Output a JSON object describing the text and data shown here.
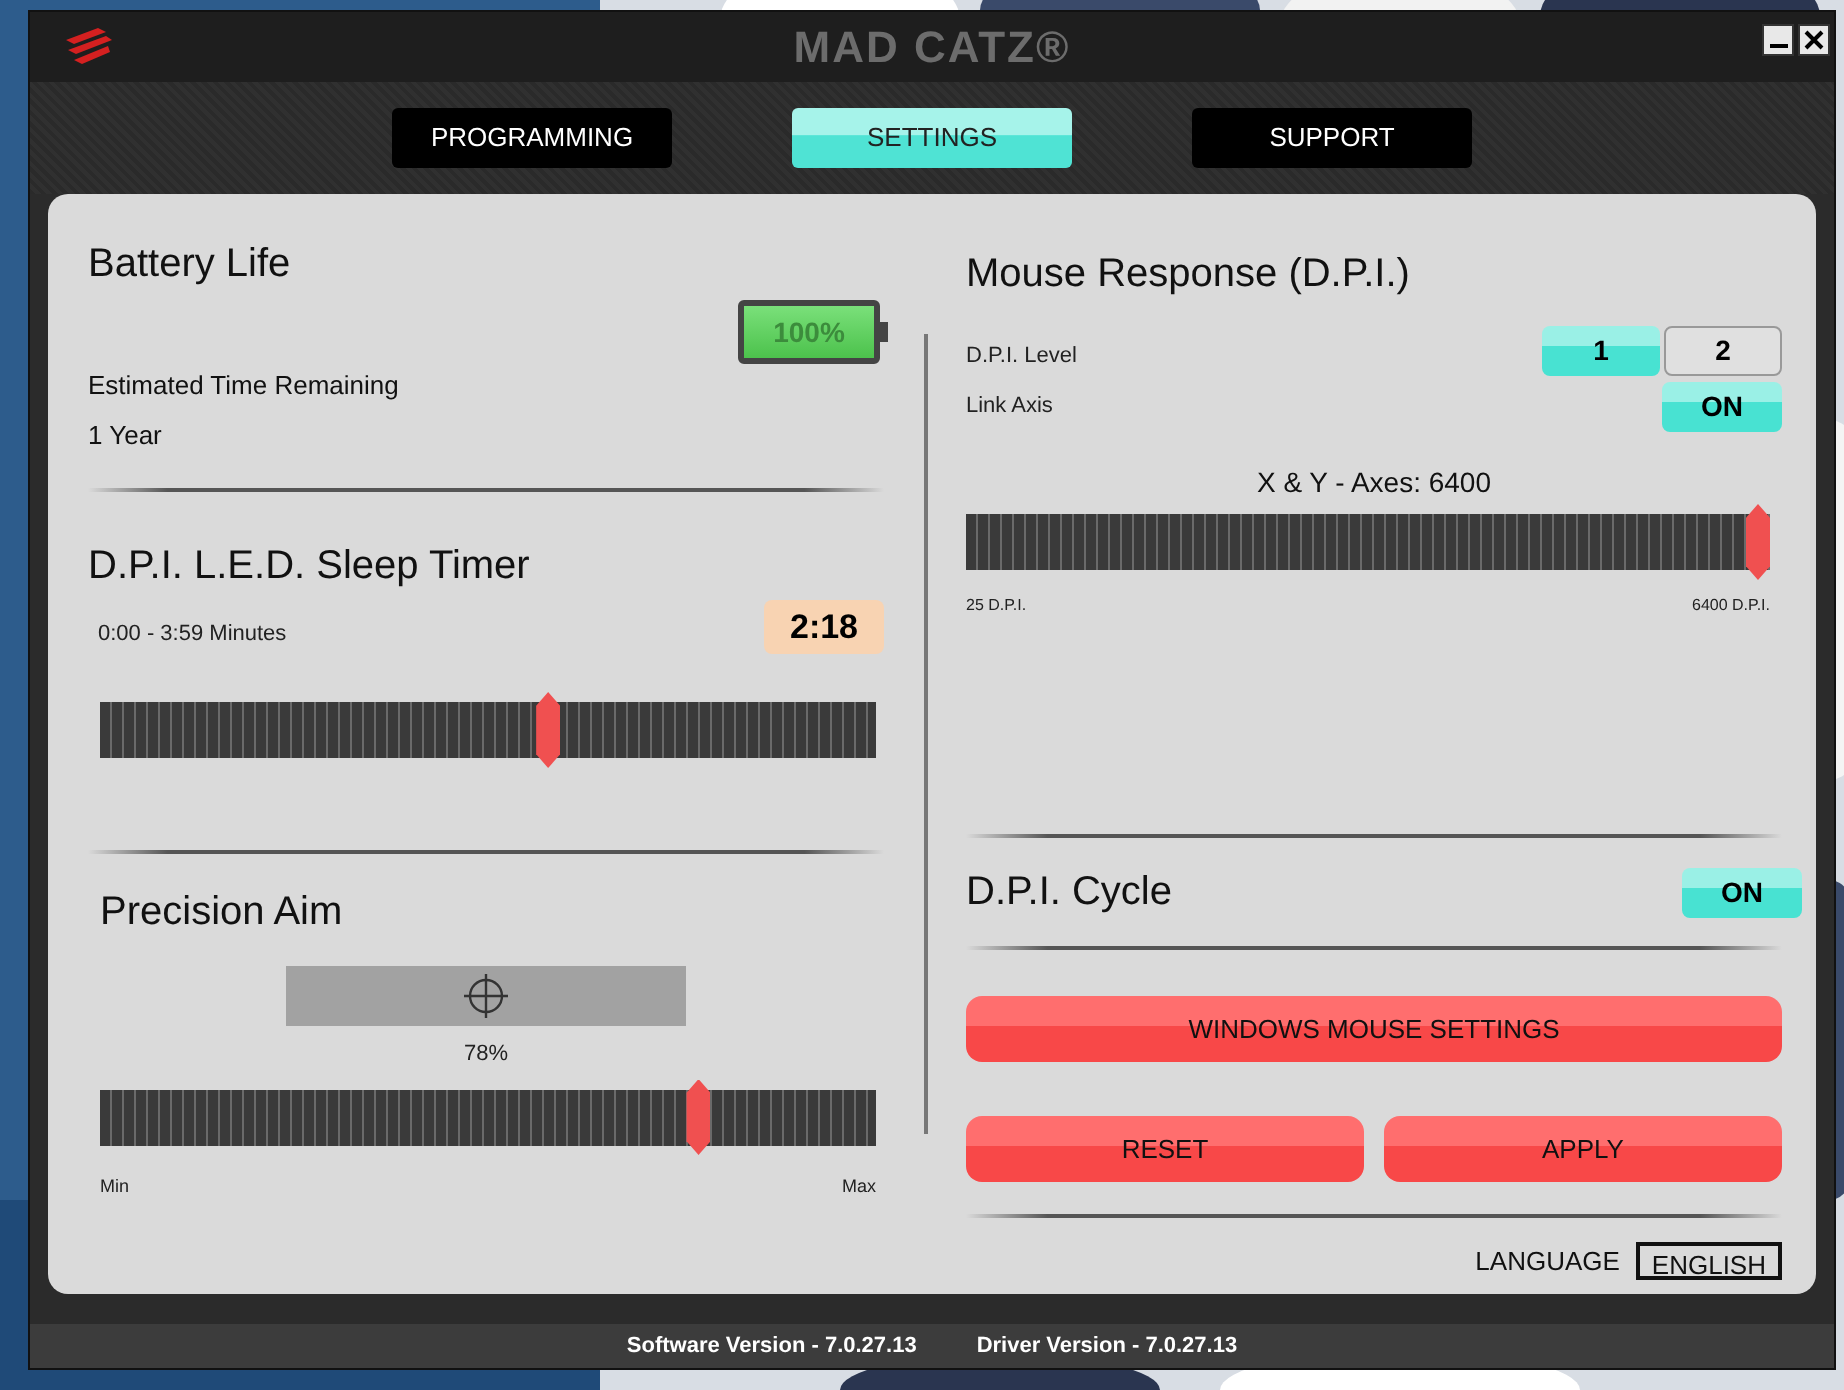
{
  "window": {
    "title": "MAD CATZ®"
  },
  "tabs": [
    {
      "label": "PROGRAMMING",
      "selected": false
    },
    {
      "label": "SETTINGS",
      "selected": true
    },
    {
      "label": "SUPPORT",
      "selected": false
    }
  ],
  "battery": {
    "title": "Battery Life",
    "level": 1,
    "reading": "100%",
    "estimate_label": "Estimated Time Remaining",
    "estimate": "1 Year"
  },
  "sleep_timer": {
    "title": "D.P.I. L.E.D. Sleep Timer",
    "range": "0:00 - 3:59 Minutes",
    "value": "2:18",
    "level": 0.58
  },
  "precision_aim": {
    "title": "Precision Aim",
    "value": "78%",
    "level": 0.78,
    "min": "Min",
    "max": "Max"
  },
  "mouse_response": {
    "title": "Mouse Response (D.P.I.)",
    "dpi_level_label": "D.P.I. Level",
    "dpi_levels": [
      {
        "label": "1",
        "selected": true
      },
      {
        "label": "2",
        "selected": false
      }
    ],
    "link_axis_label": "Link Axis",
    "link_axis": {
      "label": "ON",
      "on": true
    },
    "axes_label": "X & Y - Axes: 6400",
    "level": 1,
    "min": "25 D.P.I.",
    "max": "6400 D.P.I."
  },
  "dpi_cycle": {
    "title": "D.P.I. Cycle",
    "toggle": {
      "label": "ON",
      "on": true
    }
  },
  "buttons": [
    {
      "label": "WINDOWS MOUSE SETTINGS"
    },
    {
      "label": "RESET"
    },
    {
      "label": "APPLY"
    }
  ],
  "language": {
    "label": "LANGUAGE",
    "value": "ENGLISH"
  },
  "status_bar": [
    "Software Version - 7.0.27.13",
    "Driver Version - 7.0.27.13"
  ]
}
